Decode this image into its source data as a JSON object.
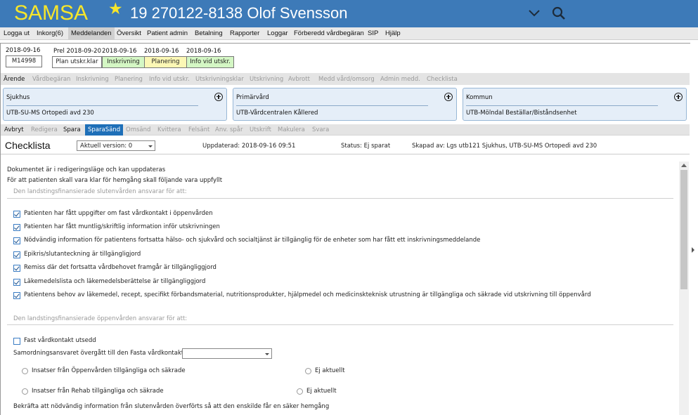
{
  "header": {
    "app_name": "SAMSA",
    "patient": "19 270122-8138 Olof Svensson",
    "colors": {
      "bar": "#3d7ab8",
      "logo": "#f7e62a"
    },
    "icons": [
      "star-icon",
      "chevron-down-icon",
      "search-icon"
    ]
  },
  "menu": [
    "Logga ut",
    "Inkorg(6)",
    "Meddelanden",
    "Översikt",
    "Patient admin",
    "Betalning",
    "Rapporter",
    "Loggar",
    "Förberedd vårdbegäran",
    "SIP",
    "Hjälp"
  ],
  "menu_active": "Meddelanden",
  "timeline": {
    "start_date": "2018-09-16",
    "start_id": "M14998",
    "steps": [
      {
        "date": "Prel 2018-09-20",
        "label": "Plan utskr.klar",
        "color": "#ffffff"
      },
      {
        "date": "2018-09-16",
        "label": "Inskrivning",
        "color": "#d4f7c4"
      },
      {
        "date": "2018-09-16",
        "label": "Planering",
        "color": "#fbf7b5"
      },
      {
        "date": "2018-09-16",
        "label": "Info vid utskr.",
        "color": "#d4f7c4"
      }
    ]
  },
  "process_tabs": [
    {
      "label": "Ärende",
      "enabled": true
    },
    {
      "label": "Vårdbegäran",
      "enabled": false
    },
    {
      "label": "Inskrivning",
      "enabled": false
    },
    {
      "label": "Planering",
      "enabled": false
    },
    {
      "label": "Info vid utskr.",
      "enabled": false
    },
    {
      "label": "Utskrivningsklar",
      "enabled": false
    },
    {
      "label": "Utskrivning",
      "enabled": false
    },
    {
      "label": "Avbrott",
      "enabled": false
    },
    {
      "label": "Medd vård/omsorg",
      "enabled": false
    },
    {
      "label": "Admin medd.",
      "enabled": false
    },
    {
      "label": "Checklista",
      "enabled": false
    }
  ],
  "units": [
    {
      "title": "Sjukhus",
      "value": "UTB-SU-MS Ortopedi avd 230"
    },
    {
      "title": "Primärvård",
      "value": "UTB-Vårdcentralen Kållered"
    },
    {
      "title": "Kommun",
      "value": "UTB-Mölndal Beställar/Biståndsenhet"
    }
  ],
  "action_tabs": [
    {
      "label": "Avbryt",
      "enabled": true
    },
    {
      "label": "Redigera",
      "enabled": false
    },
    {
      "label": "Spara",
      "enabled": true
    },
    {
      "label": "SparaSänd",
      "enabled": true,
      "selected": true
    },
    {
      "label": "Omsänd",
      "enabled": false
    },
    {
      "label": "Kvittera",
      "enabled": false
    },
    {
      "label": "Felsänt",
      "enabled": false
    },
    {
      "label": "Anv. spår",
      "enabled": false
    },
    {
      "label": "Utskrift",
      "enabled": false
    },
    {
      "label": "Makulera",
      "enabled": false
    },
    {
      "label": "Svara",
      "enabled": false
    }
  ],
  "page": {
    "title": "Checklista",
    "version_select": "Aktuell version: 0",
    "updated": "Uppdaterad: 2018-09-16 09:51",
    "status": "Status: Ej sparat",
    "created_by": "Skapad av: Lgs utb121 Sjukhus, UTB-SU-MS Ortopedi avd 230"
  },
  "intro": [
    "Dokumentet är i redigeringsläge och kan uppdateras",
    "För att patienten skall vara klar för hemgång skall följande vara uppfyllt"
  ],
  "section1": {
    "title": "Den landstingsfinansierade slutenvården ansvarar för att:",
    "items": [
      {
        "label": "Patienten har fått uppgifter om fast vårdkontakt i öppenvården",
        "checked": true
      },
      {
        "label": "Patienten har fått muntlig/skriftlig information inför utskrivningen",
        "checked": true
      },
      {
        "label": "Nödvändig information för patientens fortsatta hälso- och sjukvård och socialtjänst är tillgänglig för de enheter som har fått ett inskrivningsmeddelande",
        "checked": true
      },
      {
        "label": "Epikris/slutanteckning är tillgängligjord",
        "checked": true
      },
      {
        "label": "Remiss där det fortsatta vårdbehovet framgår är tillgängliggjord",
        "checked": true
      },
      {
        "label": "Läkemedelslista och läkemedelsberättelse är tillgängliggjord",
        "checked": true
      },
      {
        "label": "Patientens behov av läkemedel, recept, specifikt förbandsmaterial, nutritionsprodukter, hjälpmedel och medicinskteknisk utrustning är tillgängliga och säkrade vid utskrivning till öppenvård",
        "checked": true
      }
    ]
  },
  "section2": {
    "title": "Den landstingsfinansierade öppenvården ansvarar för att:",
    "fast_vardkontakt": {
      "label": "Fast vårdkontakt utsedd",
      "checked": false
    },
    "samordning_label": "Samordningsansvaret övergått till den Fasta vårdkontakten:",
    "samordning_value": "",
    "radios": [
      {
        "label": "Insatser från Öppenvården tillgängliga och säkrade",
        "alt": "Ej aktuellt"
      },
      {
        "label": "Insatser från Rehab tillgängliga och säkrade",
        "alt": "Ej aktuellt"
      }
    ],
    "confirm_text": "Bekräfta att nödvändig information från slutenvården överförts så att den enskilde får en säker hemgång"
  }
}
